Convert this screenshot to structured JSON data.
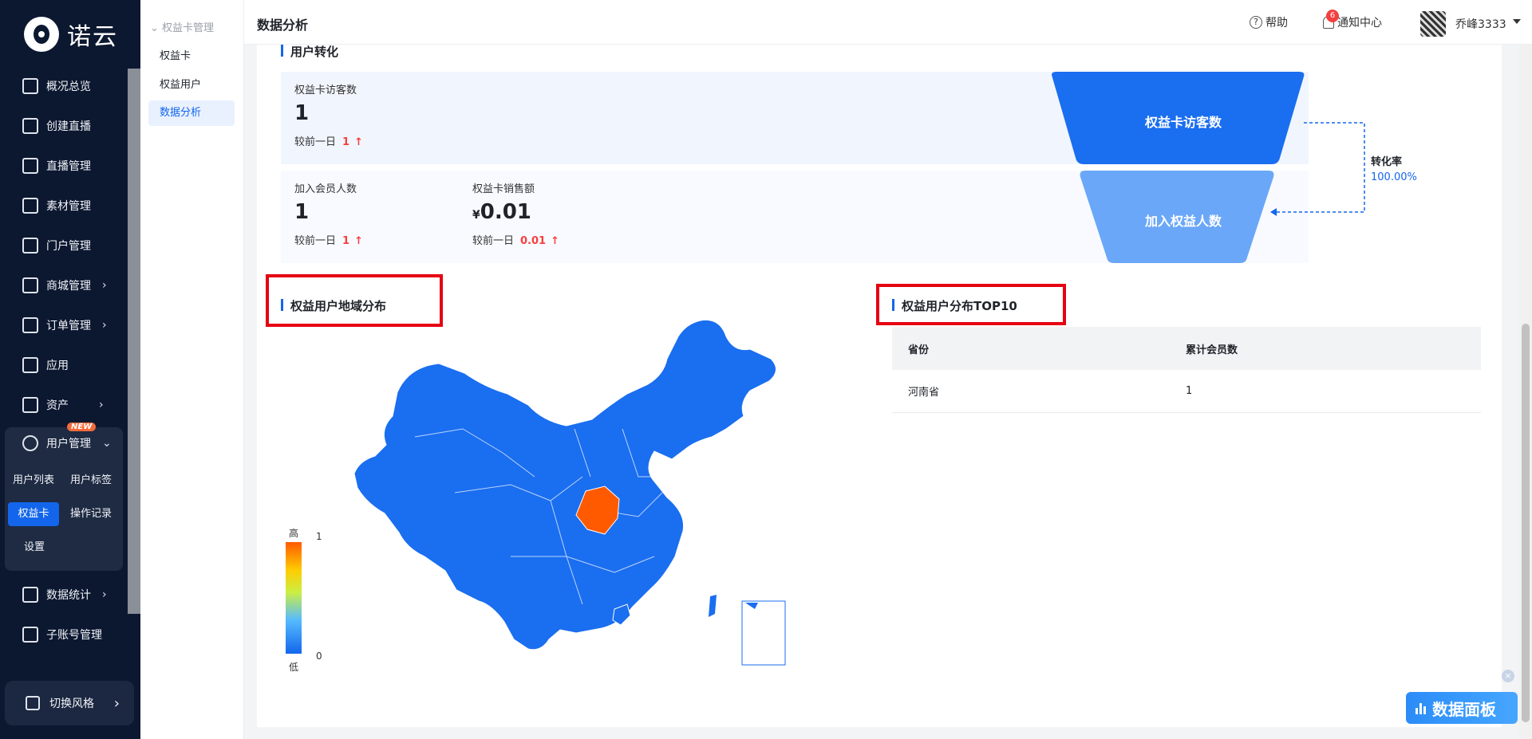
{
  "brand": {
    "name": "诺云"
  },
  "nav": {
    "items": [
      {
        "label": "概况总览",
        "icon": "dashboard-icon"
      },
      {
        "label": "创建直播",
        "icon": "add-square-icon"
      },
      {
        "label": "直播管理",
        "icon": "tv-icon"
      },
      {
        "label": "素材管理",
        "icon": "folder-icon"
      },
      {
        "label": "门户管理",
        "icon": "home-icon"
      },
      {
        "label": "商城管理",
        "icon": "shop-bag-icon"
      },
      {
        "label": "订单管理",
        "icon": "order-list-icon"
      },
      {
        "label": "应用",
        "icon": "apps-grid-icon"
      },
      {
        "label": "资产",
        "icon": "asset-icon"
      },
      {
        "label": "数据统计",
        "icon": "bar-chart-icon"
      },
      {
        "label": "子账号管理",
        "icon": "org-tree-icon"
      }
    ],
    "user_group": {
      "label": "用户管理",
      "badge": "NEW",
      "subs": [
        "用户列表",
        "用户标签",
        "权益卡",
        "操作记录",
        "设置"
      ]
    },
    "switch_style": "切换风格"
  },
  "subnav": {
    "group": "权益卡管理",
    "items": [
      "权益卡",
      "权益用户",
      "数据分析"
    ]
  },
  "topbar": {
    "title": "数据分析",
    "help": "帮助",
    "notify": "通知中心",
    "notify_count": "6",
    "user": "乔峰3333"
  },
  "conversion": {
    "title": "用户转化",
    "visitors": {
      "label": "权益卡访客数",
      "value": "1",
      "cmp_label": "较前一日",
      "cmp_value": "1"
    },
    "members": {
      "label": "加入会员人数",
      "value": "1",
      "cmp_label": "较前一日",
      "cmp_value": "1"
    },
    "sales": {
      "label": "权益卡销售额",
      "currency": "¥",
      "value": "0.01",
      "cmp_label": "较前一日",
      "cmp_value": "0.01"
    },
    "funnel": {
      "top": "权益卡访客数",
      "bottom": "加入权益人数"
    },
    "rate_label": "转化率",
    "rate_value": "100.00%"
  },
  "region": {
    "title": "权益用户地域分布",
    "legend_high": "高",
    "legend_low": "低",
    "legend_max": "1",
    "legend_min": "0",
    "highlighted_province": "河南省"
  },
  "top10": {
    "title": "权益用户分布TOP10",
    "columns": [
      "省份",
      "累计会员数"
    ],
    "rows": [
      {
        "province": "河南省",
        "count": "1"
      }
    ]
  },
  "data_panel": {
    "label": "数据面板"
  },
  "colors": {
    "primary": "#1366ec",
    "highlight": "#ff5a00",
    "funnel_top": "#1a6ef0",
    "funnel_bottom": "#6aa7f8"
  }
}
